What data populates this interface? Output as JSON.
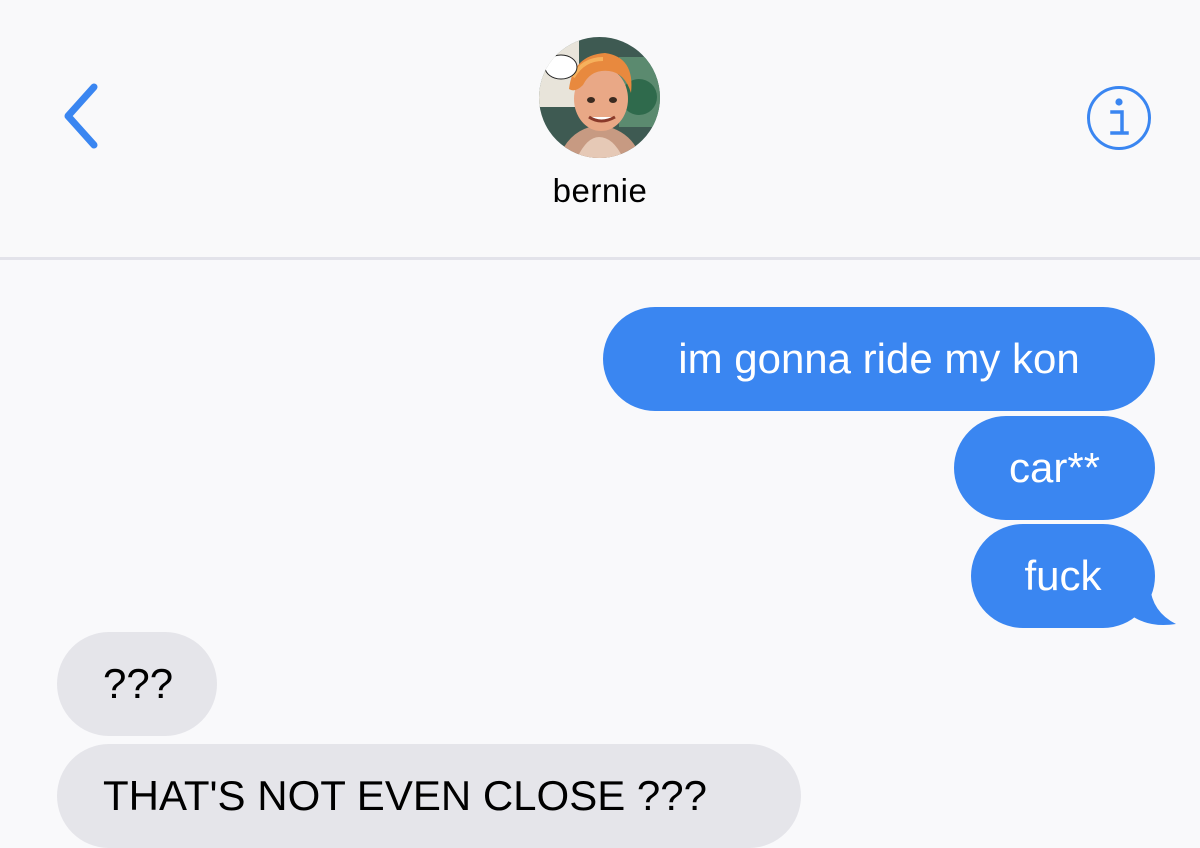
{
  "header": {
    "contact_name": "bernie"
  },
  "icons": {
    "back": "chevron-left-icon",
    "info": "info-circle-icon",
    "avatar": "contact-avatar"
  },
  "colors": {
    "accent": "#3a86f1",
    "outgoing_bubble": "#3a86f1",
    "incoming_bubble": "#e5e5ea",
    "background": "#f9f9fb"
  },
  "messages": [
    {
      "direction": "outgoing",
      "text": "im gonna ride my kon"
    },
    {
      "direction": "outgoing",
      "text": "car**"
    },
    {
      "direction": "outgoing",
      "text": "fuck"
    },
    {
      "direction": "incoming",
      "text": "???"
    },
    {
      "direction": "incoming",
      "text": "THAT'S NOT EVEN CLOSE ???"
    }
  ]
}
